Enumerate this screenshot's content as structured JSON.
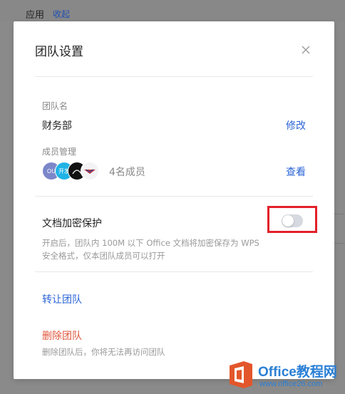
{
  "background": {
    "section_title": "应用",
    "collapse_link": "收起"
  },
  "dialog": {
    "title": "团队设置",
    "close_icon": "close-icon",
    "team_name": {
      "label": "团队名",
      "value": "财务部",
      "edit_link": "修改"
    },
    "members": {
      "label": "成员管理",
      "avatars": [
        "OU",
        "开发",
        "",
        ""
      ],
      "count_text": "4名成员",
      "view_link": "查看"
    },
    "encryption": {
      "label": "文档加密保护",
      "enabled": false,
      "description_line1": "开启后，团队内 100M 以下 Office 文档将加密保存为 WPS",
      "description_line2": "安全格式，仅本团队成员可以打开"
    },
    "transfer_link": "转让团队",
    "delete": {
      "link": "删除团队",
      "description": "删除团队后，你将无法再访问团队"
    }
  },
  "watermark": {
    "brand": "Office教程网",
    "site": "www.office26.com"
  },
  "colors": {
    "accent_blue": "#2a63d6",
    "danger_red": "#e0553c",
    "highlight_red": "#e3202a",
    "toggle_off": "#d6d9e0"
  }
}
